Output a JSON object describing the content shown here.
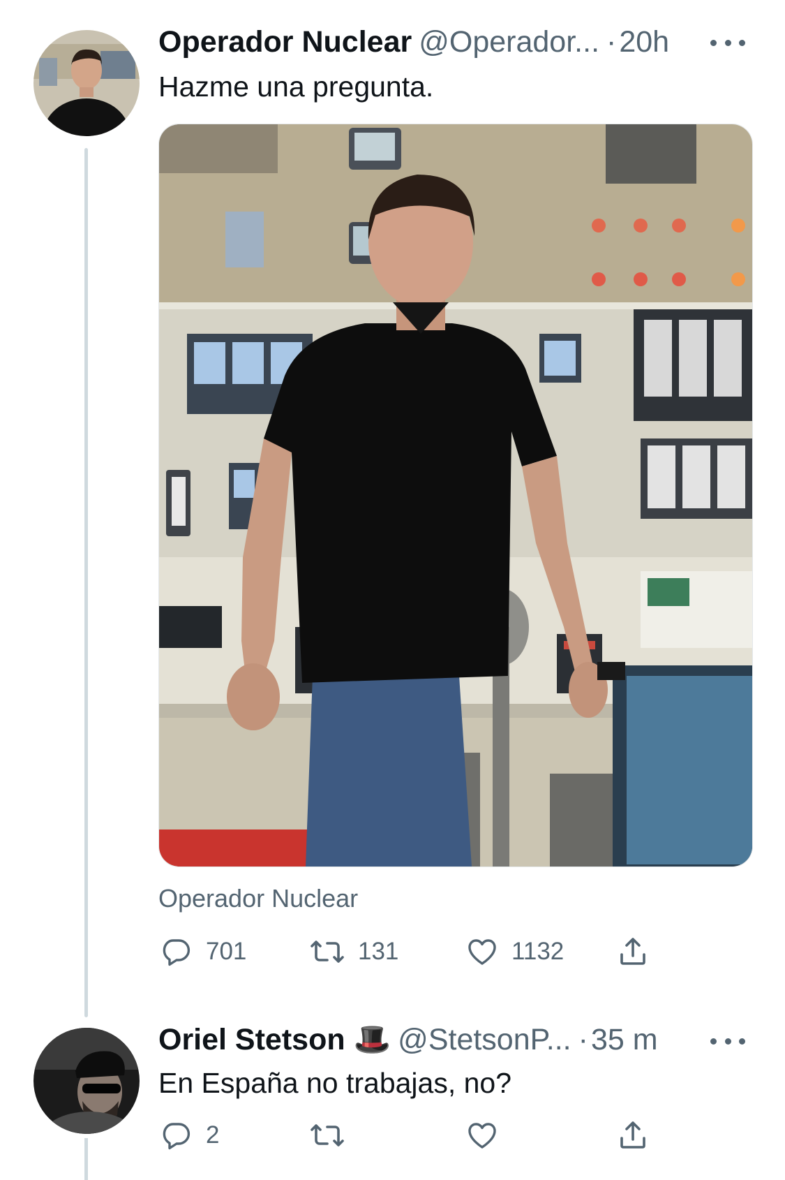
{
  "tweet": {
    "author_name": "Operador Nuclear",
    "author_handle": "@Operador...",
    "separator": "·",
    "time": "20h",
    "text": "Hazme una pregunta.",
    "media_alt": "Operador Nuclear",
    "attribution": "Operador Nuclear",
    "replies": "701",
    "retweets": "131",
    "likes": "1132"
  },
  "reply": {
    "author_name": "Oriel Stetson",
    "author_emoji": "🎩",
    "author_handle": "@StetsonP...",
    "separator": "·",
    "time": "35 m",
    "text": "En España no trabajas, no?",
    "replies": "2",
    "retweets": "",
    "likes": ""
  },
  "icons": {
    "reply": "reply-icon",
    "retweet": "retweet-icon",
    "like": "heart-icon",
    "share": "share-icon",
    "more": "more-options-icon"
  },
  "colors": {
    "text_primary": "#0f1419",
    "text_secondary": "#536471",
    "thread_line": "#cfd9de"
  }
}
